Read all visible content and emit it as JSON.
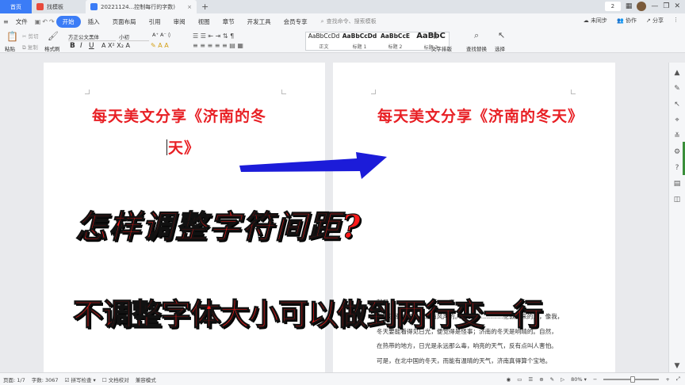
{
  "tabs": {
    "home": "首页",
    "template": "找模板",
    "document": "20221124...控制每行的字数)"
  },
  "window": {
    "badge": "2"
  },
  "menu": {
    "items": [
      "文件",
      "开始",
      "插入",
      "页面布局",
      "引用",
      "审阅",
      "视图",
      "章节",
      "开发工具",
      "会员专享"
    ],
    "active": "开始",
    "search_placeholder": "查找命令、搜索模板",
    "sync": "未同步",
    "collab": "协作",
    "share": "分享"
  },
  "ribbon": {
    "paste": "粘贴",
    "cut": "剪切",
    "copy": "复制",
    "format_painter": "格式刷",
    "font_name": "方正公文黑体",
    "font_size": "小初",
    "styles": [
      {
        "sample": "AaBbCcDd",
        "label": "正文"
      },
      {
        "sample": "AaBbCcDd",
        "label": "标题 1"
      },
      {
        "sample": "AaBbCcE",
        "label": "标题 2"
      },
      {
        "sample": "AaBbC",
        "label": "标题 3"
      }
    ],
    "text_layout": "文字排版",
    "find_replace": "查找替换",
    "select": "选择"
  },
  "document": {
    "left_title_line1": "每天美文分享《济南的冬",
    "left_title_line2": "天》",
    "right_title": "每天美文分享《济南的冬天》",
    "body_lines": [
      "就是…………………………奇",
      "迹；济南的冬天是没有风声的。对于……………伦敦回来的人，像我，",
      "冬天要能看得见日光，便觉得是怪事；济南的冬天是响晴的。自然，",
      "在热带的地方，日光是永远那么毒，响亮的天气，反有点叫人害怕。",
      "可是，在北中国的冬天，而能有温晴的天气，济南真得算个宝地。"
    ]
  },
  "overlay": {
    "line1": "怎样调整字符间距?",
    "line2": "不调整字体大小可以做到两行变一行"
  },
  "status": {
    "page": "页面: 1/7",
    "words": "字数: 3067",
    "spell": "拼写检查",
    "proof": "文档校对",
    "compat": "兼容模式",
    "zoom": "80%"
  },
  "colors": {
    "accent": "#3b7cf6",
    "title_red": "#e81f24",
    "arrow_blue": "#1c1cd9"
  }
}
